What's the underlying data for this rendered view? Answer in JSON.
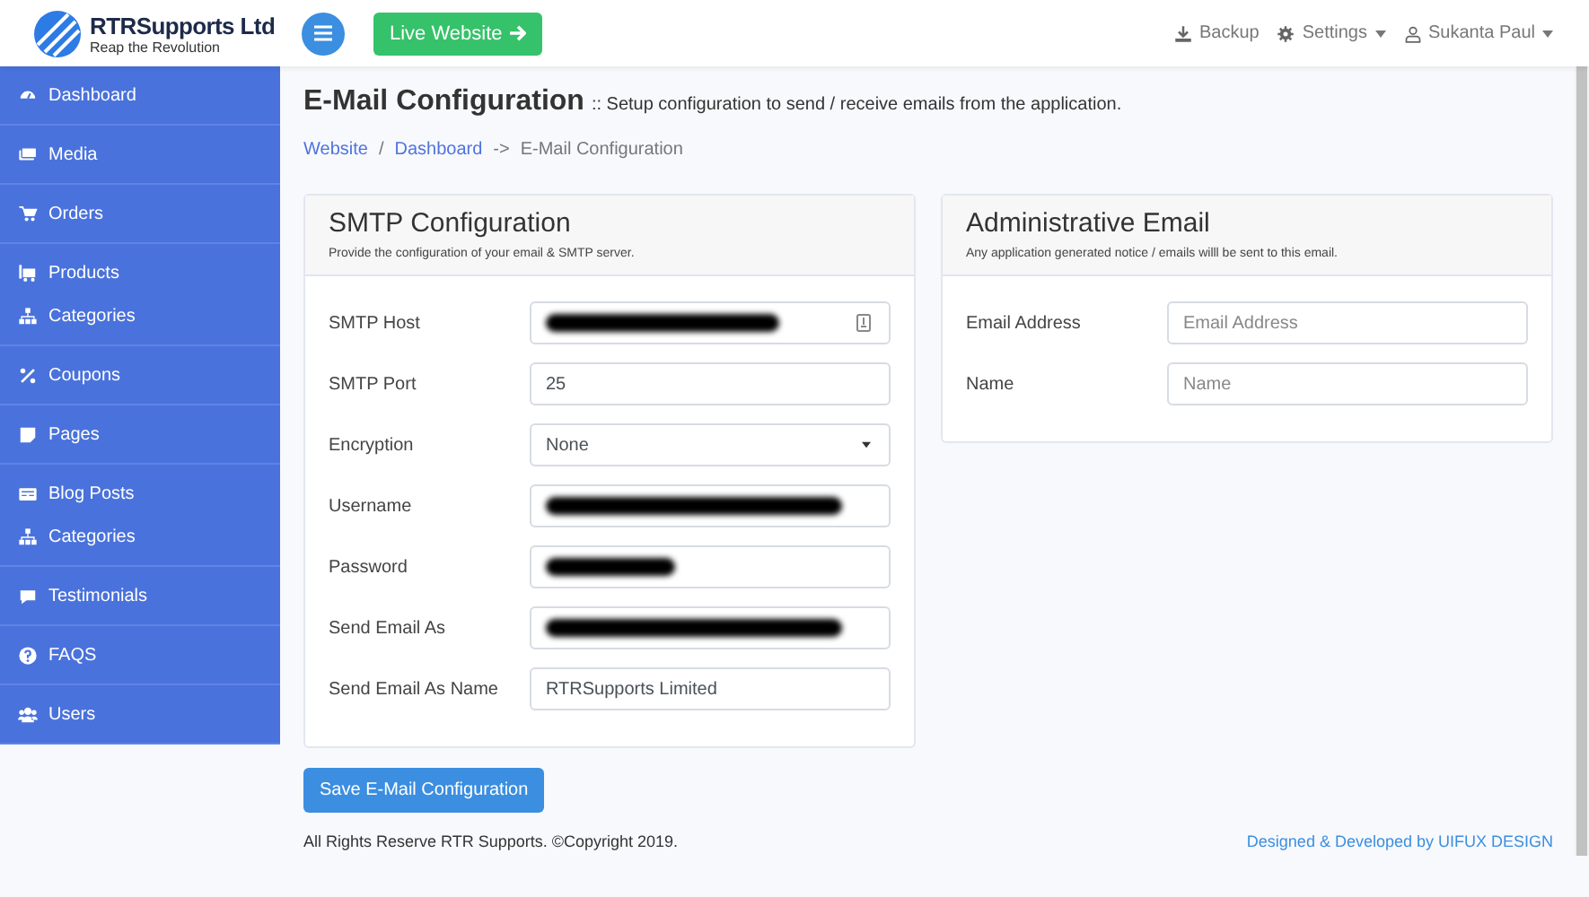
{
  "brand": {
    "name": "RTRSupports Ltd",
    "tagline": "Reap the Revolution"
  },
  "topbar": {
    "live_button": "Live Website",
    "links": [
      {
        "kind": "backup",
        "label": "Backup",
        "dropdown": false
      },
      {
        "kind": "settings",
        "label": "Settings",
        "dropdown": true
      },
      {
        "kind": "user",
        "label": "Sukanta Paul",
        "dropdown": true
      }
    ]
  },
  "sidebar": {
    "groups": [
      [
        {
          "label": "Dashboard"
        }
      ],
      [
        {
          "label": "Media"
        }
      ],
      [
        {
          "label": "Orders"
        }
      ],
      [
        {
          "label": "Products"
        },
        {
          "label": "Categories"
        }
      ],
      [
        {
          "label": "Coupons"
        }
      ],
      [
        {
          "label": "Pages"
        }
      ],
      [
        {
          "label": "Blog Posts"
        },
        {
          "label": "Categories"
        }
      ],
      [
        {
          "label": "Testimonials"
        }
      ],
      [
        {
          "label": "FAQS"
        }
      ],
      [
        {
          "label": "Users"
        }
      ]
    ]
  },
  "page": {
    "title": "E-Mail Configuration",
    "subtitle": ":: Setup configuration to send / receive emails from the application."
  },
  "breadcrumb": [
    {
      "kind": "link",
      "label": "Website"
    },
    {
      "kind": "sep",
      "label": "/"
    },
    {
      "kind": "link",
      "label": "Dashboard"
    },
    {
      "kind": "sep",
      "label": "->"
    },
    {
      "kind": "current",
      "label": "E-Mail Configuration"
    }
  ],
  "cards": [
    {
      "title": "SMTP Configuration",
      "description": "Provide the configuration of your email & SMTP server.",
      "fields": [
        {
          "label": "SMTP Host",
          "kind": "redacted",
          "autofill": true
        },
        {
          "label": "SMTP Port",
          "kind": "text",
          "value": "25",
          "autofill": false
        },
        {
          "label": "Encryption",
          "kind": "select",
          "value": "None",
          "autofill": false
        },
        {
          "label": "Username",
          "kind": "redacted",
          "autofill": false
        },
        {
          "label": "Password",
          "kind": "redacted",
          "autofill": false
        },
        {
          "label": "Send Email As",
          "kind": "redacted",
          "autofill": false
        },
        {
          "label": "Send Email As Name",
          "kind": "text",
          "value": "RTRSupports Limited",
          "autofill": false
        }
      ]
    },
    {
      "title": "Administrative Email",
      "description": "Any application generated notice / emails willl be sent to this email.",
      "fields": [
        {
          "label": "Email Address",
          "kind": "text",
          "placeholder": "Email Address",
          "autofill": false
        },
        {
          "label": "Name",
          "kind": "text",
          "placeholder": "Name",
          "autofill": false
        }
      ]
    }
  ],
  "save_button": "Save E-Mail Configuration",
  "footer": {
    "copyright": "All Rights Reserve RTR Supports. ©Copyright 2019.",
    "credit": "Designed & Developed by UIFUX DESIGN"
  }
}
